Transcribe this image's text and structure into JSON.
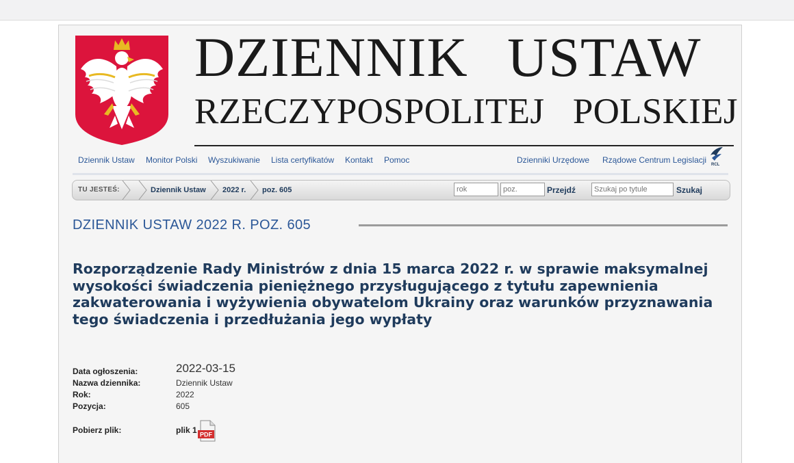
{
  "header": {
    "title_main": "DZIENNIK USTAW",
    "title_sub": "RZECZYPOSPOLITEJ POLSKIEJ",
    "emblem_icon": "polish-eagle-emblem-icon"
  },
  "nav": {
    "left": [
      "Dziennik Ustaw",
      "Monitor Polski",
      "Wyszukiwanie",
      "Lista certyfikatów",
      "Kontakt",
      "Pomoc"
    ],
    "right": [
      "Dzienniki Urzędowe",
      "Rządowe Centrum Legislacji"
    ],
    "rcl_icon": "rcl-logo-icon"
  },
  "breadcrumb": {
    "label": "TU JESTEŚ:",
    "items": [
      "Dziennik Ustaw",
      "2022 r.",
      "poz. 605"
    ],
    "rok_placeholder": "rok",
    "poz_placeholder": "poz.",
    "go_label": "Przejdź",
    "search_placeholder": "Szukaj po tytule",
    "search_label": "Szukaj"
  },
  "document": {
    "heading": "DZIENNIK USTAW 2022 R. POZ. 605",
    "title": "Rozporządzenie Rady Ministrów z dnia 15 marca 2022 r. w sprawie maksymalnej wysokości świadczenia pieniężnego przysługującego z tytułu zapewnienia zakwaterowania i wyżywienia obywatelom Ukrainy oraz warunków przyznawania tego świadczenia i przedłużania jego wypłaty",
    "meta": [
      {
        "label": "Data ogłoszenia:",
        "value": "2022-03-15"
      },
      {
        "label": "Nazwa dziennika:",
        "value": "Dziennik Ustaw"
      },
      {
        "label": "Rok:",
        "value": "2022"
      },
      {
        "label": "Pozycja:",
        "value": "605"
      }
    ],
    "download_label": "Pobierz plik:",
    "file_label": "plik 1",
    "pdf_icon": "pdf-file-icon",
    "pdf_text": "PDF"
  },
  "colors": {
    "link": "#2b5797",
    "title": "#1f3b5c",
    "emblem_red": "#dc143c"
  }
}
